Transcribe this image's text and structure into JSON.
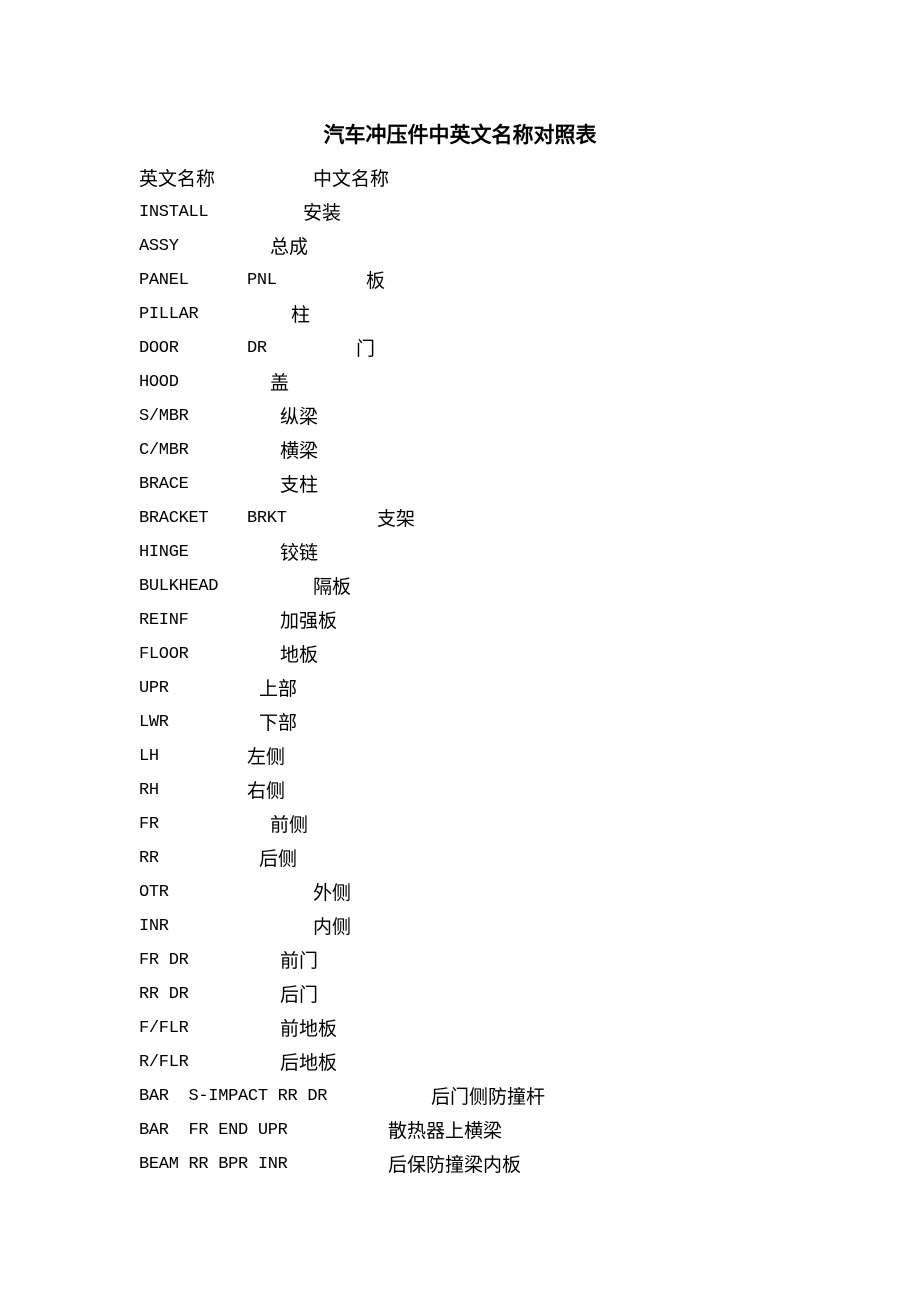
{
  "title": "汽车冲压件中英文名称对照表",
  "header": {
    "en": "英文名称",
    "zh": "中文名称"
  },
  "rows": [
    {
      "en": "INSTALL",
      "abbr": "",
      "zh": "安装"
    },
    {
      "en": "ASSY",
      "abbr": "",
      "zh": "总成"
    },
    {
      "en": "PANEL",
      "abbr": "PNL",
      "zh": "板"
    },
    {
      "en": "PILLAR",
      "abbr": "",
      "zh": "柱"
    },
    {
      "en": "DOOR",
      "abbr": "DR",
      "zh": "门"
    },
    {
      "en": "HOOD",
      "abbr": "",
      "zh": "盖"
    },
    {
      "en": "S/MBR",
      "abbr": "",
      "zh": "纵梁"
    },
    {
      "en": "C/MBR",
      "abbr": "",
      "zh": "横梁"
    },
    {
      "en": "BRACE",
      "abbr": "",
      "zh": "支柱"
    },
    {
      "en": "BRACKET",
      "abbr": "BRKT",
      "zh": "支架"
    },
    {
      "en": "HINGE",
      "abbr": "",
      "zh": "铰链"
    },
    {
      "en": "BULKHEAD",
      "abbr": "",
      "zh": "隔板"
    },
    {
      "en": "REINF",
      "abbr": "",
      "zh": "加强板"
    },
    {
      "en": "FLOOR",
      "abbr": "",
      "zh": "地板"
    },
    {
      "en": "UPR",
      "abbr": "",
      "zh": "上部"
    },
    {
      "en": "LWR",
      "abbr": "",
      "zh": "下部"
    },
    {
      "en": "LH",
      "abbr": "",
      "zh": "左侧"
    },
    {
      "en": "RH",
      "abbr": "",
      "zh": "右侧"
    },
    {
      "en": "FR",
      "abbr": "",
      "zh": "前侧"
    },
    {
      "en": "RR",
      "abbr": "",
      "zh": "后侧"
    },
    {
      "en": "OTR",
      "abbr": "",
      "zh": "外侧"
    },
    {
      "en": "INR",
      "abbr": "",
      "zh": "内侧"
    },
    {
      "en": "FR DR",
      "abbr": "",
      "zh": "前门"
    },
    {
      "en": "RR DR",
      "abbr": "",
      "zh": "后门"
    },
    {
      "en": "F/FLR",
      "abbr": "",
      "zh": "前地板"
    },
    {
      "en": "R/FLR",
      "abbr": "",
      "zh": "后地板"
    },
    {
      "en": "BAR  S-IMPACT RR DR",
      "abbr": "",
      "zh": "后门侧防撞杆"
    },
    {
      "en": "BAR  FR END UPR",
      "abbr": "",
      "zh": "散热器上横梁"
    },
    {
      "en": "BEAM RR BPR INR",
      "abbr": "",
      "zh": "后保防撞梁内板"
    }
  ]
}
